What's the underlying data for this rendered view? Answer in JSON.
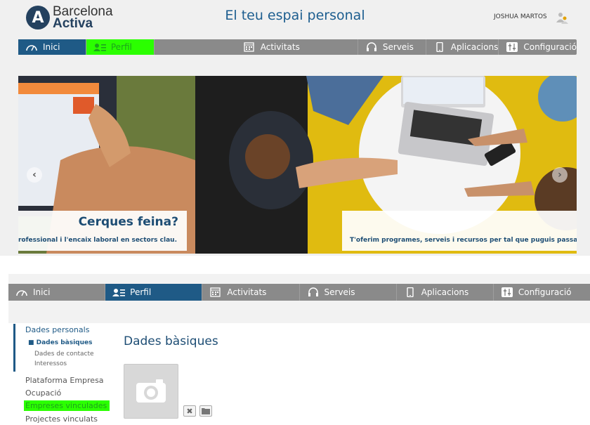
{
  "header": {
    "logo_line1": "Barcelona",
    "logo_line2": "Activa",
    "logo_letter": "A",
    "title": "El teu espai personal",
    "user_name": "JOSHUA MARTOS"
  },
  "nav_top": [
    {
      "label": "Inici",
      "icon": "dashboard-icon",
      "state": "active"
    },
    {
      "label": "Perfil",
      "icon": "profile-icon",
      "state": "highlighted"
    },
    {
      "label": "Activitats",
      "icon": "calendar-icon",
      "state": "normal"
    },
    {
      "label": "Serveis",
      "icon": "headset-icon",
      "state": "normal"
    },
    {
      "label": "Aplicacions",
      "icon": "mobile-icon",
      "state": "normal"
    },
    {
      "label": "Configuració",
      "icon": "sliders-icon",
      "state": "normal"
    }
  ],
  "hero": {
    "left_title": "Cerques feina?",
    "left_subtitle": "ó professional i l'encaix laboral en sectors clau.",
    "right_subtitle": "T'oferim programes, serveis i recursos per tal que puguis passar de",
    "prev_icon": "chevron-left-icon",
    "next_icon": "chevron-right-icon"
  },
  "nav_bottom": [
    {
      "label": "Inici",
      "icon": "dashboard-icon",
      "state": "normal"
    },
    {
      "label": "Perfil",
      "icon": "profile-icon",
      "state": "active"
    },
    {
      "label": "Activitats",
      "icon": "calendar-icon",
      "state": "normal"
    },
    {
      "label": "Serveis",
      "icon": "headset-icon",
      "state": "normal"
    },
    {
      "label": "Aplicacions",
      "icon": "mobile-icon",
      "state": "normal"
    },
    {
      "label": "Configuració",
      "icon": "sliders-icon",
      "state": "normal"
    }
  ],
  "sidebar": {
    "section_title": "Dades personals",
    "sub_selected": "Dades bàsiques",
    "sub_contact": "Dades de contacte",
    "sub_interests": "Interessos",
    "item_platform": "Plataforma Empresa",
    "item_occupation": "Ocupació",
    "item_companies": "Empreses vinculades",
    "item_projects": "Projectes vinculats"
  },
  "main": {
    "title": "Dades bàsiques",
    "photo_icon": "camera-icon",
    "delete_icon": "close-icon",
    "upload_icon": "folder-icon"
  },
  "colors": {
    "brand_blue": "#1f5a86",
    "nav_gray": "#8a8a8a",
    "highlight_green": "#2bff00"
  }
}
